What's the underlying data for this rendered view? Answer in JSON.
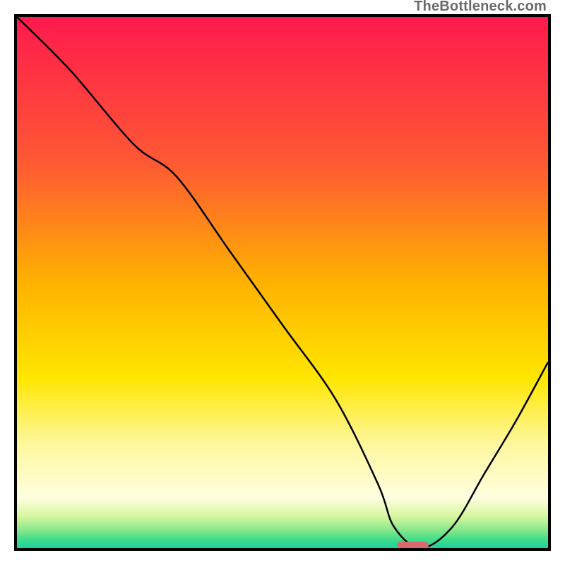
{
  "watermark": "TheBottleneck.com",
  "chart_data": {
    "type": "line",
    "title": "",
    "xlabel": "",
    "ylabel": "",
    "xlim": [
      0,
      100
    ],
    "ylim": [
      0,
      100
    ],
    "grid": false,
    "legend": false,
    "gradient_stops": [
      {
        "offset": 0.0,
        "color": "#ff1a4d"
      },
      {
        "offset": 0.28,
        "color": "#ff5a33"
      },
      {
        "offset": 0.5,
        "color": "#ffb200"
      },
      {
        "offset": 0.68,
        "color": "#ffe600"
      },
      {
        "offset": 0.8,
        "color": "#fff79a"
      },
      {
        "offset": 0.905,
        "color": "#ffffe0"
      },
      {
        "offset": 0.94,
        "color": "#d6f7a0"
      },
      {
        "offset": 0.965,
        "color": "#8be88b"
      },
      {
        "offset": 0.985,
        "color": "#3ddc8a"
      },
      {
        "offset": 1.0,
        "color": "#1dd1a1"
      }
    ],
    "series": [
      {
        "name": "bottleneck-curve",
        "stroke": "#000000",
        "stroke_width": 2.5,
        "x": [
          0,
          10,
          22,
          30,
          40,
          50,
          60,
          68,
          71,
          76,
          82,
          88,
          94,
          100
        ],
        "y": [
          100,
          90,
          76,
          70,
          56,
          42,
          28,
          12,
          4,
          0,
          4,
          14,
          24,
          35
        ]
      }
    ],
    "marker": {
      "name": "optimal-range",
      "x_start": 71.5,
      "x_end": 77.5,
      "y": 0.6,
      "color": "#d86a6e"
    },
    "annotations": []
  }
}
